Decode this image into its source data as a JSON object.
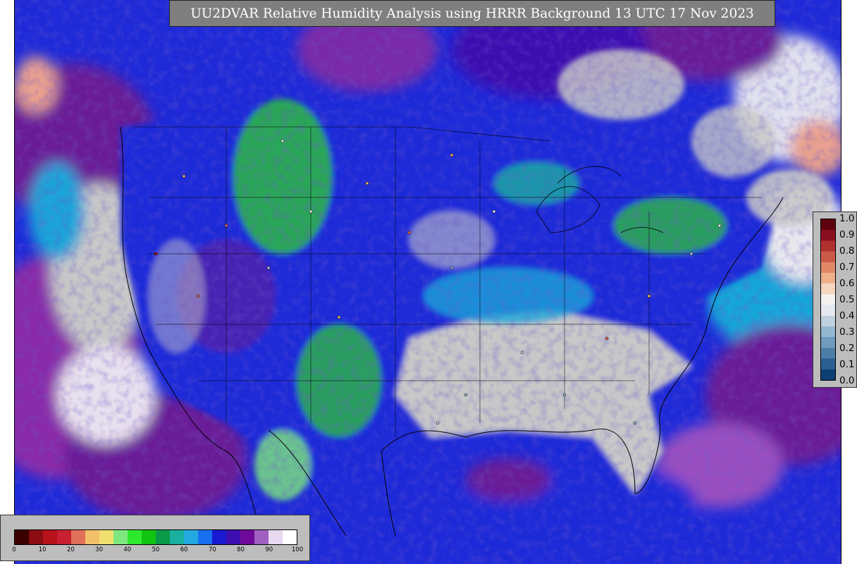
{
  "title": "UU2DVAR Relative Humidity Analysis using HRRR Background 13 UTC 17 Nov 2023",
  "horizontal_colorbar": {
    "ticks": [
      "0",
      "10",
      "20",
      "30",
      "40",
      "50",
      "60",
      "70",
      "80",
      "90",
      "100"
    ],
    "min": 0,
    "max": 100,
    "palette": [
      "#3a0000",
      "#8c0c14",
      "#b5121b",
      "#c82030",
      "#e0705a",
      "#f2c069",
      "#f0e070",
      "#7ee87e",
      "#2ee82e",
      "#12c412",
      "#0a9a4a",
      "#1ab0a0",
      "#24a8e0",
      "#1870f0",
      "#1a1ad0",
      "#3e0fb0",
      "#6e0a9a",
      "#a060c0",
      "#e8d8f0",
      "#ffffff"
    ]
  },
  "vertical_colorbar": {
    "ticks": [
      "0.0",
      "0.1",
      "0.2",
      "0.3",
      "0.4",
      "0.5",
      "0.6",
      "0.7",
      "0.8",
      "0.9",
      "1.0"
    ],
    "min": 0,
    "max": 1,
    "palette": [
      "#0d3f72",
      "#2b5f91",
      "#4c7ea8",
      "#6f9bbd",
      "#95b6cf",
      "#bed0de",
      "#e3e9ee",
      "#f4f2ef",
      "#f5d6c0",
      "#efb08c",
      "#e08868",
      "#cc5a48",
      "#b1302f",
      "#8a1020",
      "#5e0010"
    ]
  },
  "colors": {
    "ocean_purple": "#6a1e96",
    "ocean_blue": "#1e2ad8",
    "ocean_cyan": "#19a6d8",
    "land_gray": "#c8c8c8",
    "green": "#2fd02f"
  }
}
